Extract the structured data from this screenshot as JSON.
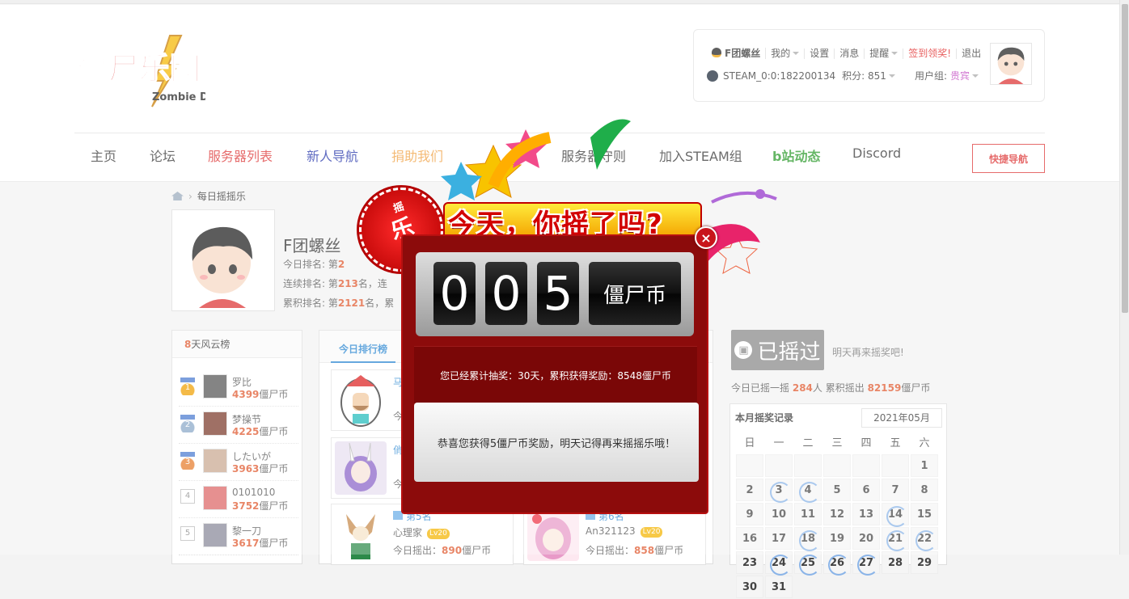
{
  "logo": {
    "text": "僵尸乐园",
    "sub": "Zombie Den"
  },
  "userbox": {
    "username": "F团螺丝",
    "my": "我的",
    "settings": "设置",
    "messages": "消息",
    "remind": "提醒",
    "signin": "签到领奖!",
    "logout": "退出",
    "steam_id": "STEAM_0:0:182200134",
    "points": "积分: 851",
    "group_label": "用户组:",
    "group_value": "贵宾"
  },
  "nav": {
    "items": [
      "主页",
      "论坛",
      "服务器列表",
      "新人导航",
      "捐助我们",
      "服务器守则",
      "加入STEAM组",
      "b站动态",
      "Discord"
    ],
    "quick": "快捷导航"
  },
  "breadcrumb": {
    "current": "每日摇摇乐"
  },
  "profile": {
    "name": "F团螺丝",
    "today_rank_prefix": "今日排名: 第",
    "today_rank_value": "2",
    "streak_rank_prefix": "连续排名: 第",
    "streak_rank_value": "213",
    "streak_rank_suffix": "名，连",
    "total_rank_prefix": "累积排名: 第",
    "total_rank_value": "2121",
    "total_rank_suffix": "名，累"
  },
  "leaderboard": {
    "title_num": "8",
    "title_text": "天风云榜",
    "coin_unit": "僵尸币",
    "items": [
      {
        "rank": "1",
        "name": "罗比",
        "coins": "4399"
      },
      {
        "rank": "2",
        "name": "梦操节",
        "coins": "4225"
      },
      {
        "rank": "3",
        "name": "したいが",
        "coins": "3963"
      },
      {
        "rank": "4",
        "name": "0101010",
        "coins": "3752"
      },
      {
        "rank": "5",
        "name": "黎一刀",
        "coins": "3617"
      }
    ]
  },
  "daily": {
    "tab": "今日排行榜",
    "cards": [
      {
        "rank": "马",
        "name": "",
        "today": "今"
      },
      {
        "rank": "俏",
        "name": "",
        "today": "今"
      },
      {
        "rank": "第5名",
        "name": "心理家",
        "level": "Lv20",
        "today_prefix": "今日摇出：",
        "today_value": "890",
        "unit": "僵尸币"
      },
      {
        "rank": "第6名",
        "name": "An321123",
        "level": "Lv20",
        "today_prefix": "今日摇出：",
        "today_value": "858",
        "unit": "僵尸币"
      }
    ]
  },
  "shake": {
    "button": "已摇过",
    "hint": "明天再来摇奖吧!",
    "stats_prefix": "今日已摇一摇",
    "stats_people": "284",
    "stats_mid": "人 累积摇出",
    "stats_total": "82159",
    "stats_unit": "僵尸币"
  },
  "calendar": {
    "title": "本月摇奖记录",
    "month": "2021年05月",
    "weekdays": [
      "日",
      "一",
      "二",
      "三",
      "四",
      "五",
      "六"
    ],
    "marked": [
      3,
      4,
      14,
      18,
      21,
      22,
      24,
      25,
      26,
      27
    ]
  },
  "modal": {
    "badge_small": "摇",
    "badge_big": "乐",
    "banner": "今天，你摇了吗?",
    "digits": [
      "0",
      "0",
      "5"
    ],
    "coin_label": "僵尸币",
    "summary": "您已经累计抽奖：30天，累积获得奖励：8548僵尸币",
    "message": "恭喜您获得5僵尸币奖励，明天记得再来摇摇乐哦！",
    "close": "×"
  },
  "colors": {
    "accent_orange": "#e0572c",
    "accent_blue": "#2b87d1",
    "modal_red": "#8c0b0b",
    "nav_red": "#d33",
    "nav_green": "#2a9a2a"
  }
}
